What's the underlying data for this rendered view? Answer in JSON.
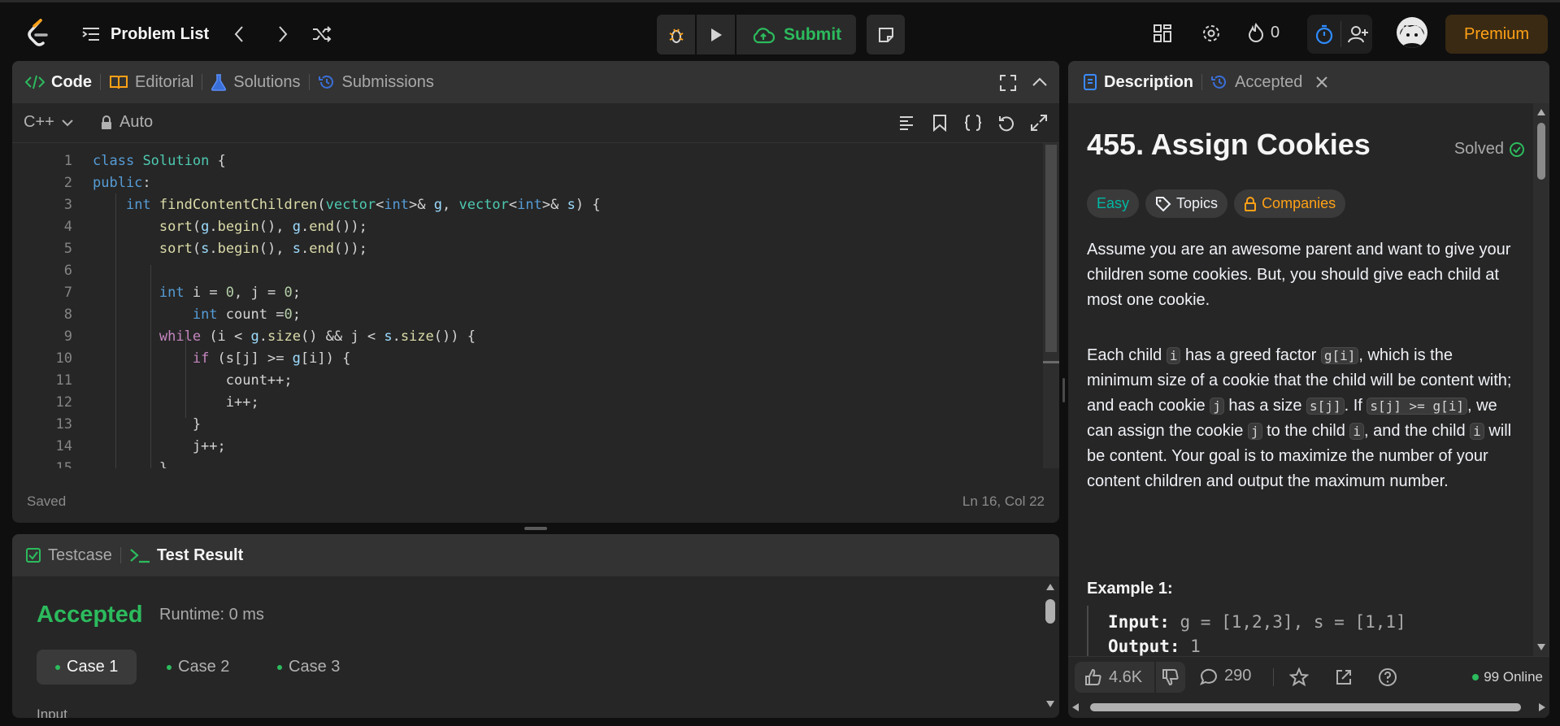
{
  "topbar": {
    "problem_list_label": "Problem List",
    "submit_label": "Submit",
    "streak_count": "0",
    "premium_label": "Premium"
  },
  "code_panel": {
    "tabs": [
      {
        "label": "Code",
        "active": true,
        "icon": "code-icon"
      },
      {
        "label": "Editorial",
        "active": false,
        "icon": "book-icon"
      },
      {
        "label": "Solutions",
        "active": false,
        "icon": "flask-icon"
      },
      {
        "label": "Submissions",
        "active": false,
        "icon": "history-icon"
      }
    ],
    "language": "C++",
    "mode": "Auto",
    "status": "Saved",
    "cursor_position": "Ln 16, Col 22",
    "lines": [
      "class Solution {",
      "public:",
      "    int findContentChildren(vector<int>& g, vector<int>& s) {",
      "        sort(g.begin(), g.end());",
      "        sort(s.begin(), s.end());",
      "",
      "        int i = 0, j = 0;",
      "            int count =0;",
      "        while (i < g.size() && j < s.size()) {",
      "            if (s[j] >= g[i]) {",
      "                count++;",
      "                i++;",
      "            }",
      "            j++;",
      "        }"
    ]
  },
  "result_panel": {
    "tabs": [
      {
        "label": "Testcase",
        "active": false
      },
      {
        "label": "Test Result",
        "active": true
      }
    ],
    "status": "Accepted",
    "runtime": "Runtime: 0 ms",
    "cases": [
      "Case 1",
      "Case 2",
      "Case 3"
    ],
    "input_label": "Input"
  },
  "desc_panel": {
    "tabs": [
      {
        "label": "Description",
        "active": true
      },
      {
        "label": "Accepted",
        "active": false
      }
    ],
    "title": "455. Assign Cookies",
    "solved_label": "Solved",
    "difficulty": "Easy",
    "topics_label": "Topics",
    "companies_label": "Companies",
    "para1": "Assume you are an awesome parent and want to give your children some cookies. But, you should give each child at most one cookie.",
    "example_title": "Example 1:",
    "example_input_label": "Input:",
    "example_input_value": "g = [1,2,3], s = [1,1]",
    "example_output_label": "Output:",
    "example_output_value": "1",
    "likes": "4.6K",
    "comments": "290",
    "online": "99 Online"
  },
  "colors": {
    "accent_green": "#2cbb5d",
    "easy_teal": "#00b8a3",
    "premium_orange": "#ffa116",
    "blue": "#007bff"
  }
}
